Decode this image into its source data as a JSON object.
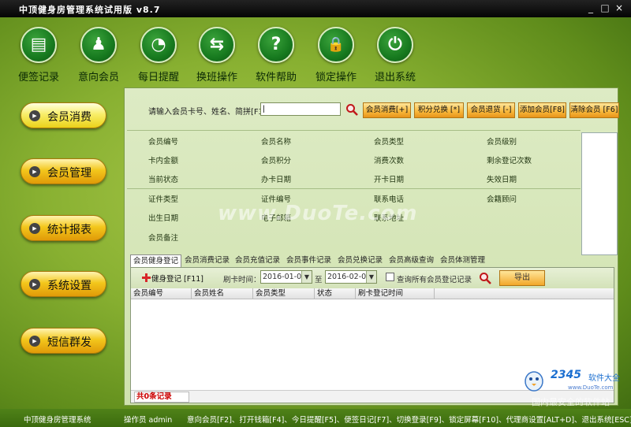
{
  "window": {
    "title": "中顶健身房管理系统试用版   v8.7",
    "controls": [
      "_",
      "□",
      "×"
    ]
  },
  "toolbar": [
    {
      "label": "便签记录",
      "icon": "notepad-icon",
      "glyph": "▤"
    },
    {
      "label": "意向会员",
      "icon": "prospect-member-icon",
      "glyph": "♟"
    },
    {
      "label": "每日提醒",
      "icon": "alarm-clock-icon",
      "glyph": "◔"
    },
    {
      "label": "换班操作",
      "icon": "shift-change-icon",
      "glyph": "⇆"
    },
    {
      "label": "软件帮助",
      "icon": "help-icon",
      "glyph": "?"
    },
    {
      "label": "锁定操作",
      "icon": "lock-icon",
      "glyph": "🔒"
    },
    {
      "label": "退出系统",
      "icon": "power-icon",
      "glyph": "⏻"
    }
  ],
  "nav": [
    {
      "label": "会员消费",
      "active": true
    },
    {
      "label": "会员管理",
      "active": false
    },
    {
      "label": "统计报表",
      "active": false
    },
    {
      "label": "系统设置",
      "active": false
    },
    {
      "label": "短信群发",
      "active": false
    }
  ],
  "search": {
    "label": "请输入会员卡号、姓名、简拼[F3]",
    "value": "|",
    "placeholder": ""
  },
  "actions": [
    "会员消费[+]",
    "积分兑换 [*]",
    "会员退货 [-]",
    "添加会员[F8]",
    "清除会员 [F6]"
  ],
  "fields": [
    [
      "会员编号",
      "会员名称",
      "会员类型",
      "会员级别"
    ],
    [
      "卡内金额",
      "会员积分",
      "消费次数",
      "剩余登记次数"
    ],
    [
      "当前状态",
      "办卡日期",
      "开卡日期",
      "失效日期"
    ],
    [
      "证件类型",
      "证件编号",
      "联系电话",
      "会籍顾问"
    ],
    [
      "出生日期",
      "电子邮箱",
      "联系地址",
      ""
    ],
    [
      "会员备注",
      "",
      "",
      ""
    ]
  ],
  "watermark": "www.DuoTe.com",
  "tabs": [
    "会员健身登记",
    "会员消费记录",
    "会员充值记录",
    "会员事件记录",
    "会员兑换记录",
    "会员高级查询",
    "会员体测管理"
  ],
  "checkin": {
    "button_label": "健身登记 [F11]",
    "time_label": "刷卡时间：",
    "date_from": "2016-01-02",
    "to_label": "至",
    "date_to": "2016-02-02",
    "query_all_label": "查询所有会员登记记录",
    "query_all_checked": false,
    "export_label": "导出"
  },
  "grid": {
    "columns": [
      "会员编号",
      "会员姓名",
      "会员类型",
      "状态",
      "刷卡登记时间"
    ],
    "rows": []
  },
  "record_count": "共0条记录",
  "status": {
    "app": "中顶健身房管理系统",
    "operator": "操作员 admin",
    "shortcuts": "意向会员[F2]、打开钱箱[F4]、今日提醒[F5]、便签日记[F7]、切换登录[F9]、锁定屏幕[F10]、代理商设置[ALT+D]、退出系统[ESC]"
  },
  "badge": {
    "brand": "2345",
    "brand_suffix": "软件大全",
    "url": "www.DuoTe.com",
    "tagline": "国内最安全的软件站"
  }
}
